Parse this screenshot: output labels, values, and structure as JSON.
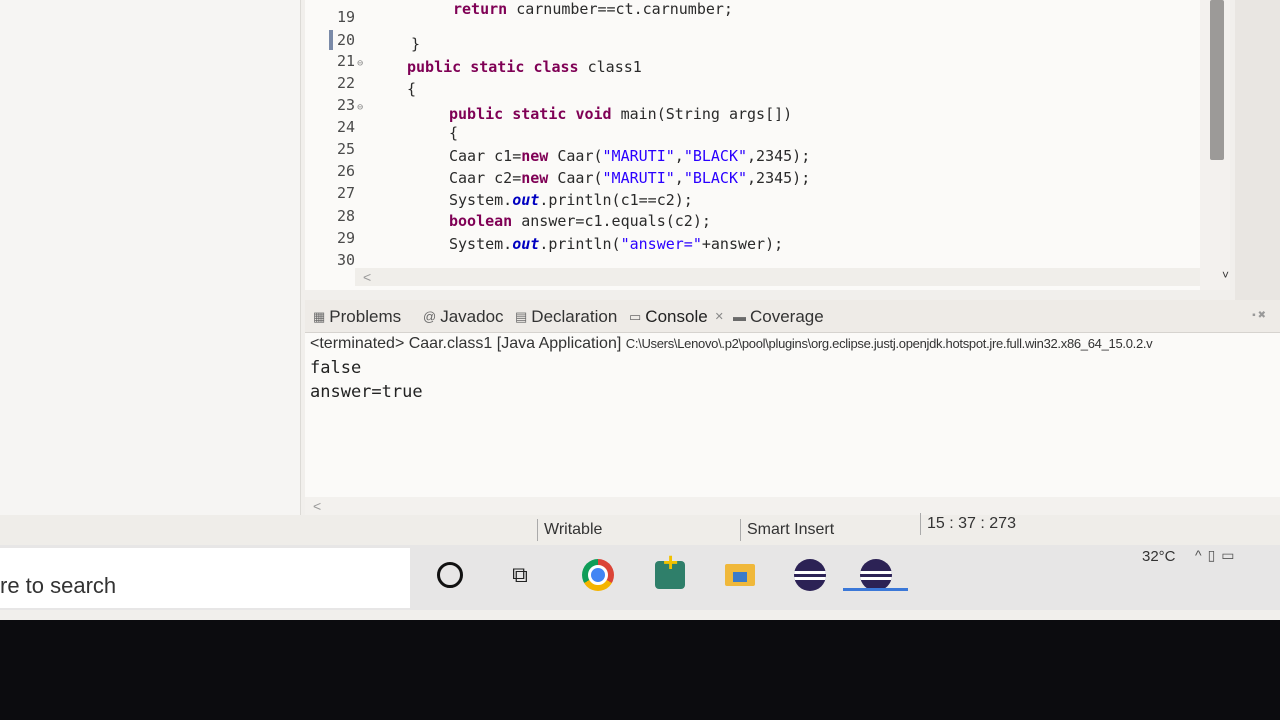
{
  "editor": {
    "line_numbers": [
      "19",
      "20",
      "21",
      "22",
      "23",
      "24",
      "25",
      "26",
      "27",
      "28",
      "29",
      "30"
    ],
    "code": {
      "l19": {
        "kw1": "return",
        "rest": " carnumber==ct.carnumber;"
      },
      "l20": {
        "text": "}"
      },
      "l21": {
        "kw1": "public",
        "kw2": "static",
        "kw3": "class",
        "rest": " class1"
      },
      "l22": {
        "text": "{"
      },
      "l23": {
        "kw1": "public",
        "kw2": "static",
        "kw3": "void",
        "rest": " main(String args[])"
      },
      "l24": {
        "text": "{"
      },
      "l25": {
        "a": "Caar c1=",
        "kw": "new",
        "b": " Caar(",
        "s1": "\"MARUTI\"",
        "c": ",",
        "s2": "\"BLACK\"",
        "d": ",2345);"
      },
      "l26": {
        "a": "Caar c2=",
        "kw": "new",
        "b": " Caar(",
        "s1": "\"MARUTI\"",
        "c": ",",
        "s2": "\"BLACK\"",
        "d": ",2345);"
      },
      "l27": {
        "a": "System.",
        "fld": "out",
        "b": ".println(c1==c2);"
      },
      "l28": {
        "kw": "boolean",
        "b": " answer=c1.equals(c2);"
      },
      "l29": {
        "a": "System.",
        "fld": "out",
        "b": ".println(",
        "s1": "\"answer=\"",
        "c": "+answer);"
      }
    }
  },
  "tabs": {
    "problems": "Problems",
    "javadoc": "Javadoc",
    "declaration": "Declaration",
    "console": "Console",
    "coverage": "Coverage"
  },
  "console": {
    "status": "<terminated> Caar.class1 [Java Application]",
    "path": "C:\\Users\\Lenovo\\.p2\\pool\\plugins\\org.eclipse.justj.openjdk.hotspot.jre.full.win32.x86_64_15.0.2.v",
    "output": [
      "false",
      "answer=true"
    ]
  },
  "status_bar": {
    "mode": "Writable",
    "insert": "Smart Insert",
    "position": "15 : 37 : 273"
  },
  "taskbar": {
    "search_text": "re to search",
    "temperature": "32°C"
  },
  "icons": [
    "cortana-icon",
    "task-view-icon",
    "chrome-icon",
    "app-plus-icon",
    "file-explorer-icon",
    "eclipse-icon"
  ]
}
